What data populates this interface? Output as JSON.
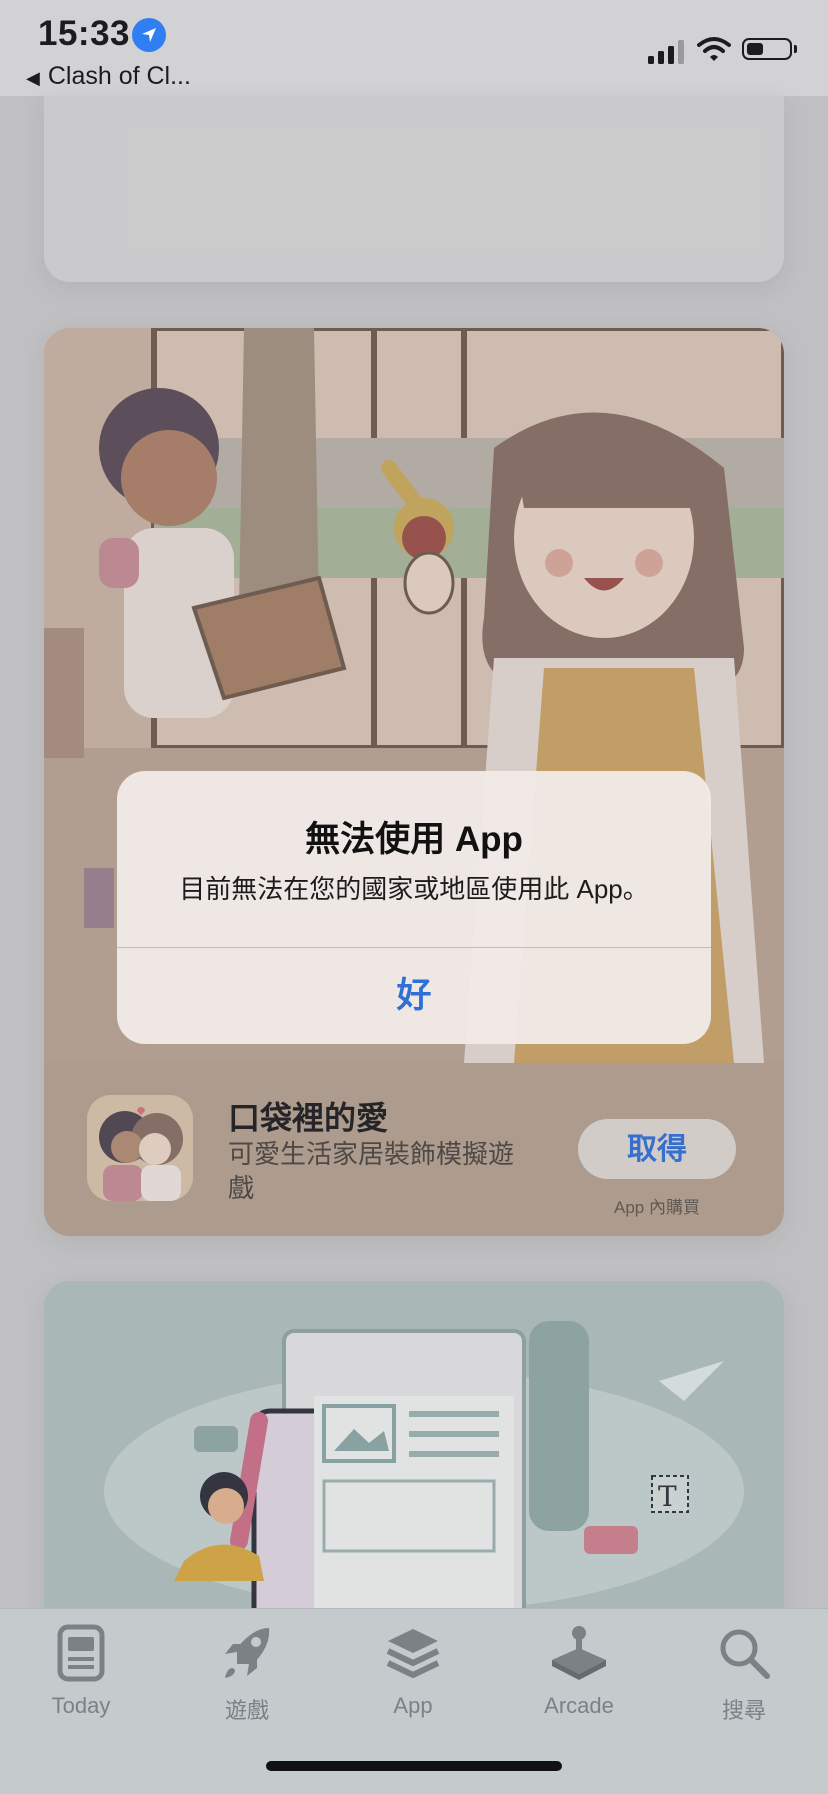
{
  "status_bar": {
    "time": "15:33",
    "back_label": "Clash of Cl...",
    "icons": [
      "location-arrow-icon",
      "signal-bars-icon",
      "wifi-icon",
      "battery-icon"
    ]
  },
  "featured_app": {
    "name": "口袋裡的愛",
    "subtitle": "可愛生活家居裝飾模擬遊戲",
    "get_label": "取得",
    "iap_label": "App 內購買"
  },
  "alert": {
    "title": "無法使用 App",
    "message": "目前無法在您的國家或地區使用此 App。",
    "ok_label": "好"
  },
  "tab_bar": {
    "tabs": [
      {
        "label": "Today",
        "icon": "today-icon"
      },
      {
        "label": "遊戲",
        "icon": "rocket-icon"
      },
      {
        "label": "App",
        "icon": "app-stack-icon"
      },
      {
        "label": "Arcade",
        "icon": "joystick-icon"
      },
      {
        "label": "搜尋",
        "icon": "search-icon"
      }
    ]
  },
  "colors": {
    "accent": "#2f6fd6",
    "tab_inactive": "#7c8185"
  }
}
